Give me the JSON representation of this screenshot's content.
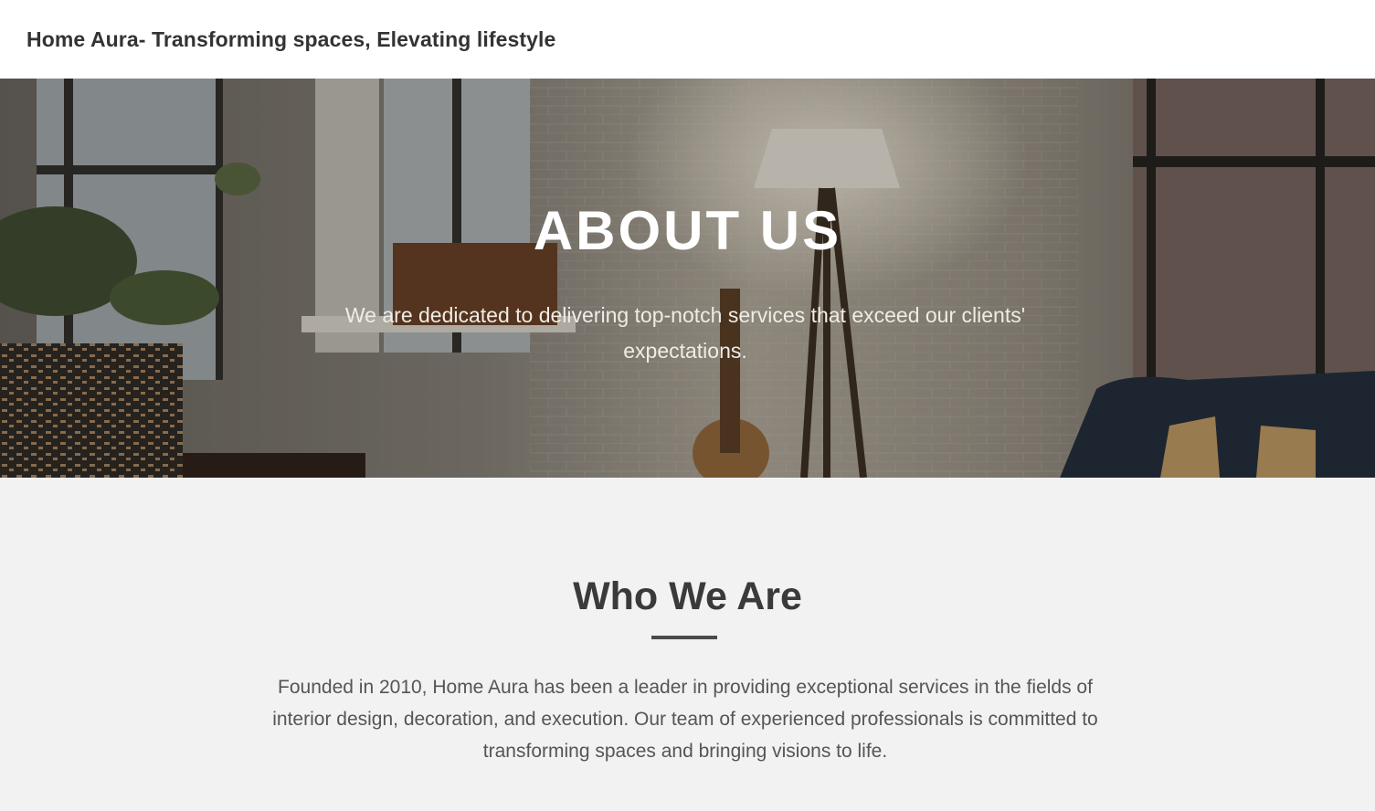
{
  "header": {
    "brand": "Home Aura- Transforming spaces, Elevating lifestyle"
  },
  "hero": {
    "title": "ABOUT US",
    "subtitle": "We are dedicated to delivering top-notch services that exceed our clients' expectations.",
    "background_image": "living-room-photo"
  },
  "about": {
    "title": "Who We Are",
    "body": "Founded in 2010, Home Aura has been a leader in providing exceptional services in the fields of interior design, decoration, and execution. Our team of experienced professionals is committed to transforming spaces and bringing visions to life."
  },
  "colors": {
    "header_bg": "#ffffff",
    "section_bg": "#f2f2f2",
    "heading_text": "#333333",
    "body_text": "#555555",
    "hero_text": "#ffffff"
  }
}
